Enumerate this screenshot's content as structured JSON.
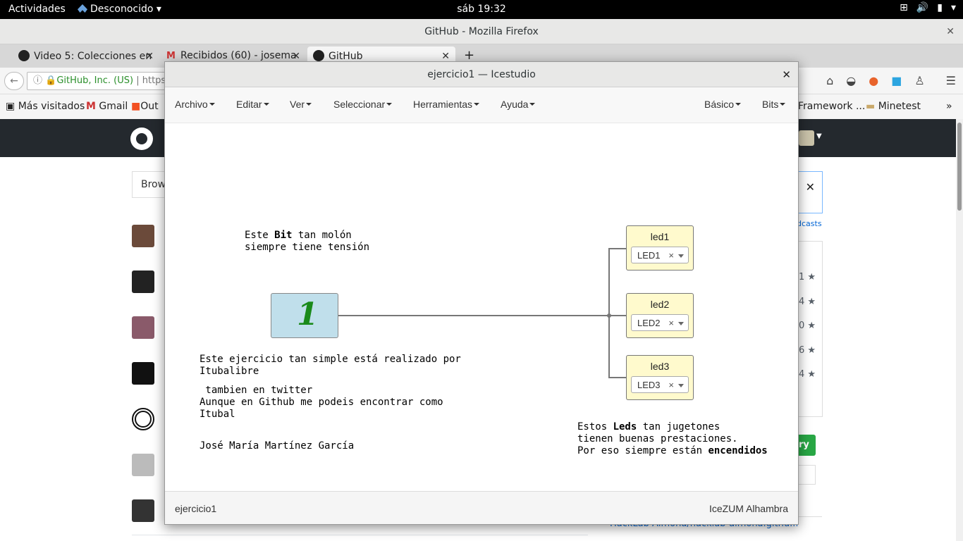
{
  "topbar": {
    "activities": "Actividades",
    "app_name": "Desconocido",
    "clock": "sáb 19:32"
  },
  "firefox": {
    "window_title": "GitHub - Mozilla Firefox",
    "tabs": [
      {
        "label": "Video 5: Colecciones en"
      },
      {
        "label": "Recibidos (60) - josema"
      },
      {
        "label": "GitHub"
      }
    ],
    "url_identity": "GitHub, Inc. (US)",
    "url_text": "https:/",
    "bookmarks": [
      "Más visitados",
      "Gmail",
      "Out",
      "Framework ...",
      "Minetest"
    ]
  },
  "github": {
    "browse_label": "Brow",
    "podcasts_link": "dcasts",
    "star_counts": [
      "1",
      "4",
      "0",
      "6",
      "4"
    ],
    "green_button": "ry",
    "bottom_link": "HackLab Almona/hacklab-almona.githu..."
  },
  "icestudio": {
    "window_title": "ejercicio1 — Icestudio",
    "menu_left": [
      "Archivo",
      "Editar",
      "Ver",
      "Seleccionar",
      "Herramientas",
      "Ayuda"
    ],
    "menu_right": [
      "Básico",
      "Bits"
    ],
    "constant_value": "1",
    "comments": {
      "bit_line1_a": "Este ",
      "bit_line1_b": "Bit",
      "bit_line1_c": " tan molón",
      "bit_line2": "siempre tiene tensión",
      "author_1": "Este ejercicio tan simple está realizado por\nItubalibre",
      "author_2": " tambien en twitter\nAunque en Github me podeis encontrar como\nItubal",
      "author_3": "José María Martínez García",
      "leds_line1_a": "Estos ",
      "leds_line1_b": "Leds",
      "leds_line1_c": " tan jugetones",
      "leds_line2": "tienen buenas prestaciones.",
      "leds_line3_a": "Por eso siempre están ",
      "leds_line3_b": "encendidos"
    },
    "leds": [
      {
        "name": "led1",
        "pin": "LED1"
      },
      {
        "name": "led2",
        "pin": "LED2"
      },
      {
        "name": "led3",
        "pin": "LED3"
      }
    ],
    "footer_left": "ejercicio1",
    "footer_right": "IceZUM Alhambra"
  }
}
